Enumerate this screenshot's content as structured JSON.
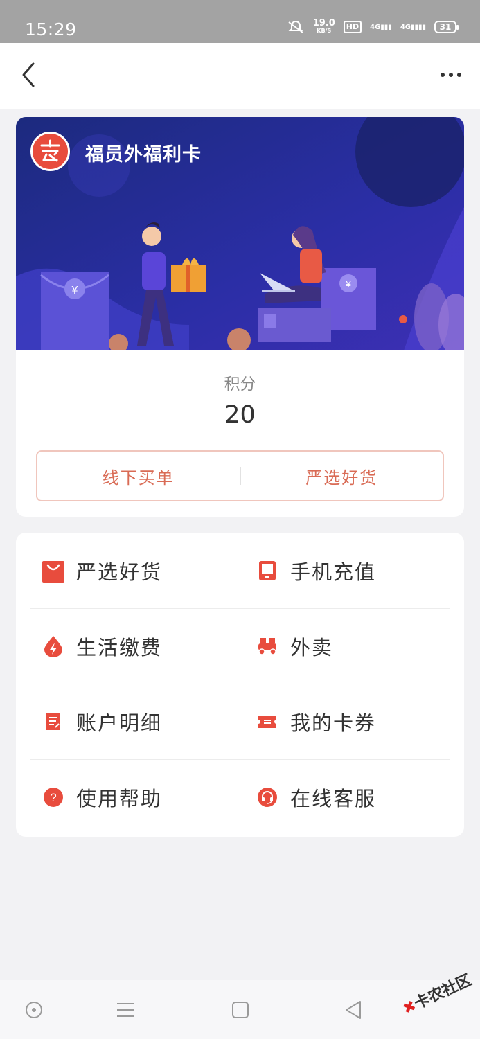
{
  "status_bar": {
    "time": "15:29",
    "speed_value": "19.0",
    "speed_unit": "KB/S",
    "hd": "HD",
    "net1": "4G",
    "net2": "4G",
    "battery": "31"
  },
  "nav": {
    "back_icon": "chevron-left-icon",
    "more_icon": "more-horizontal-icon"
  },
  "card": {
    "name": "福员外福利卡",
    "points_label": "积分",
    "points_value": "20",
    "actions": [
      "线下买单",
      "严选好货"
    ]
  },
  "menu": {
    "items": [
      {
        "label": "严选好货",
        "icon": "shopping-bag-icon"
      },
      {
        "label": "手机充值",
        "icon": "phone-icon"
      },
      {
        "label": "生活缴费",
        "icon": "bolt-drop-icon"
      },
      {
        "label": "外卖",
        "icon": "scooter-icon"
      },
      {
        "label": "账户明细",
        "icon": "document-icon"
      },
      {
        "label": "我的卡券",
        "icon": "ticket-icon"
      },
      {
        "label": "使用帮助",
        "icon": "help-icon"
      },
      {
        "label": "在线客服",
        "icon": "headset-icon"
      }
    ]
  },
  "watermark": {
    "text": "卡农社区"
  },
  "colors": {
    "accent": "#e84c3d",
    "banner_dark": "#1b2a7a",
    "banner_light": "#4a3fc9"
  }
}
